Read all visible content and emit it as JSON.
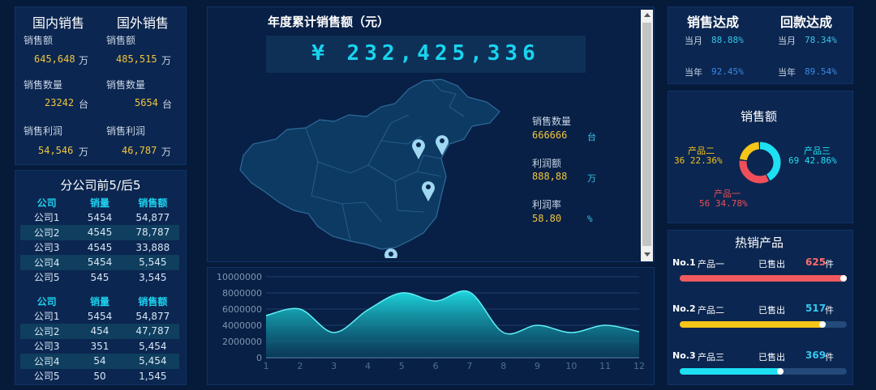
{
  "domestic": {
    "title": "国内销售",
    "sales_label": "销售额",
    "sales_value": "645,648",
    "sales_unit": "万",
    "qty_label": "销售数量",
    "qty_value": "23242",
    "qty_unit": "台",
    "profit_label": "销售利润",
    "profit_value": "54,546",
    "profit_unit": "万"
  },
  "foreign": {
    "title": "国外销售",
    "sales_label": "销售额",
    "sales_value": "485,515",
    "sales_unit": "万",
    "qty_label": "销售数量",
    "qty_value": "5654",
    "qty_unit": "台",
    "profit_label": "销售利润",
    "profit_value": "46,787",
    "profit_unit": "万"
  },
  "branches": {
    "title": "分公司前5/后5",
    "headers": [
      "公司",
      "销量",
      "销售额"
    ],
    "top5": [
      [
        "公司1",
        "5454",
        "54,877"
      ],
      [
        "公司2",
        "4545",
        "78,787"
      ],
      [
        "公司3",
        "4545",
        "33,888"
      ],
      [
        "公司4",
        "5454",
        "5,545"
      ],
      [
        "公司5",
        "545",
        "3,545"
      ]
    ],
    "bottom5": [
      [
        "公司1",
        "5454",
        "54,877"
      ],
      [
        "公司2",
        "454",
        "47,787"
      ],
      [
        "公司3",
        "351",
        "5,454"
      ],
      [
        "公司4",
        "54",
        "5,454"
      ],
      [
        "公司5",
        "50",
        "1,545"
      ]
    ]
  },
  "center": {
    "title": "年度累计销售额（元）",
    "total": "¥ 232,425,336",
    "metrics": [
      {
        "label": "销售数量",
        "value": "666666",
        "unit": "台"
      },
      {
        "label": "利润额",
        "value": "888,88",
        "unit": "万"
      },
      {
        "label": "利润率",
        "value": "58.80",
        "unit": "%"
      }
    ]
  },
  "achieve": {
    "sales_title": "销售达成",
    "return_title": "回款达成",
    "month_label": "当月",
    "year_label": "当年",
    "sales_month": "88.88%",
    "sales_year": "92.45%",
    "return_month": "78.34%",
    "return_year": "89.54%"
  },
  "donut": {
    "title": "销售额",
    "slices": [
      {
        "name": "产品一",
        "value": 56,
        "pct": "34.78%",
        "color": "#f04f5a"
      },
      {
        "name": "产品二",
        "value": 36,
        "pct": "22.36%",
        "color": "#f5c518"
      },
      {
        "name": "产品三",
        "value": 69,
        "pct": "42.86%",
        "color": "#1ee0f2"
      }
    ]
  },
  "hot": {
    "title": "热销产品",
    "sold_label": "已售出",
    "unit": "件",
    "items": [
      {
        "rank": "No.1",
        "name": "产品一",
        "count": "625",
        "level": 1.0,
        "color": "#f05a5f",
        "numcolor": "#ff6b6b"
      },
      {
        "rank": "No.2",
        "name": "产品二",
        "count": "517",
        "level": 0.875,
        "color": "#f5c518",
        "numcolor": "#35c8f0"
      },
      {
        "rank": "No.3",
        "name": "产品三",
        "count": "369",
        "level": 0.62,
        "color": "#1ee0f2",
        "numcolor": "#35c8f0"
      }
    ]
  },
  "chart_data": {
    "type": "area",
    "x": [
      1,
      2,
      3,
      4,
      5,
      6,
      7,
      8,
      9,
      10,
      11,
      12
    ],
    "values": [
      5200000,
      6000000,
      3100000,
      5900000,
      8000000,
      7000000,
      8100000,
      3100000,
      4000000,
      3100000,
      4000000,
      3200000
    ],
    "ylim": [
      0,
      10000000
    ],
    "yticks": [
      "10000000",
      "8000000",
      "6000000",
      "4000000",
      "2000000",
      "0"
    ],
    "xticks": [
      "1",
      "2",
      "3",
      "4",
      "5",
      "6",
      "7",
      "8",
      "9",
      "10",
      "11",
      "12"
    ],
    "grid": true,
    "color": "#1ee0e6"
  }
}
